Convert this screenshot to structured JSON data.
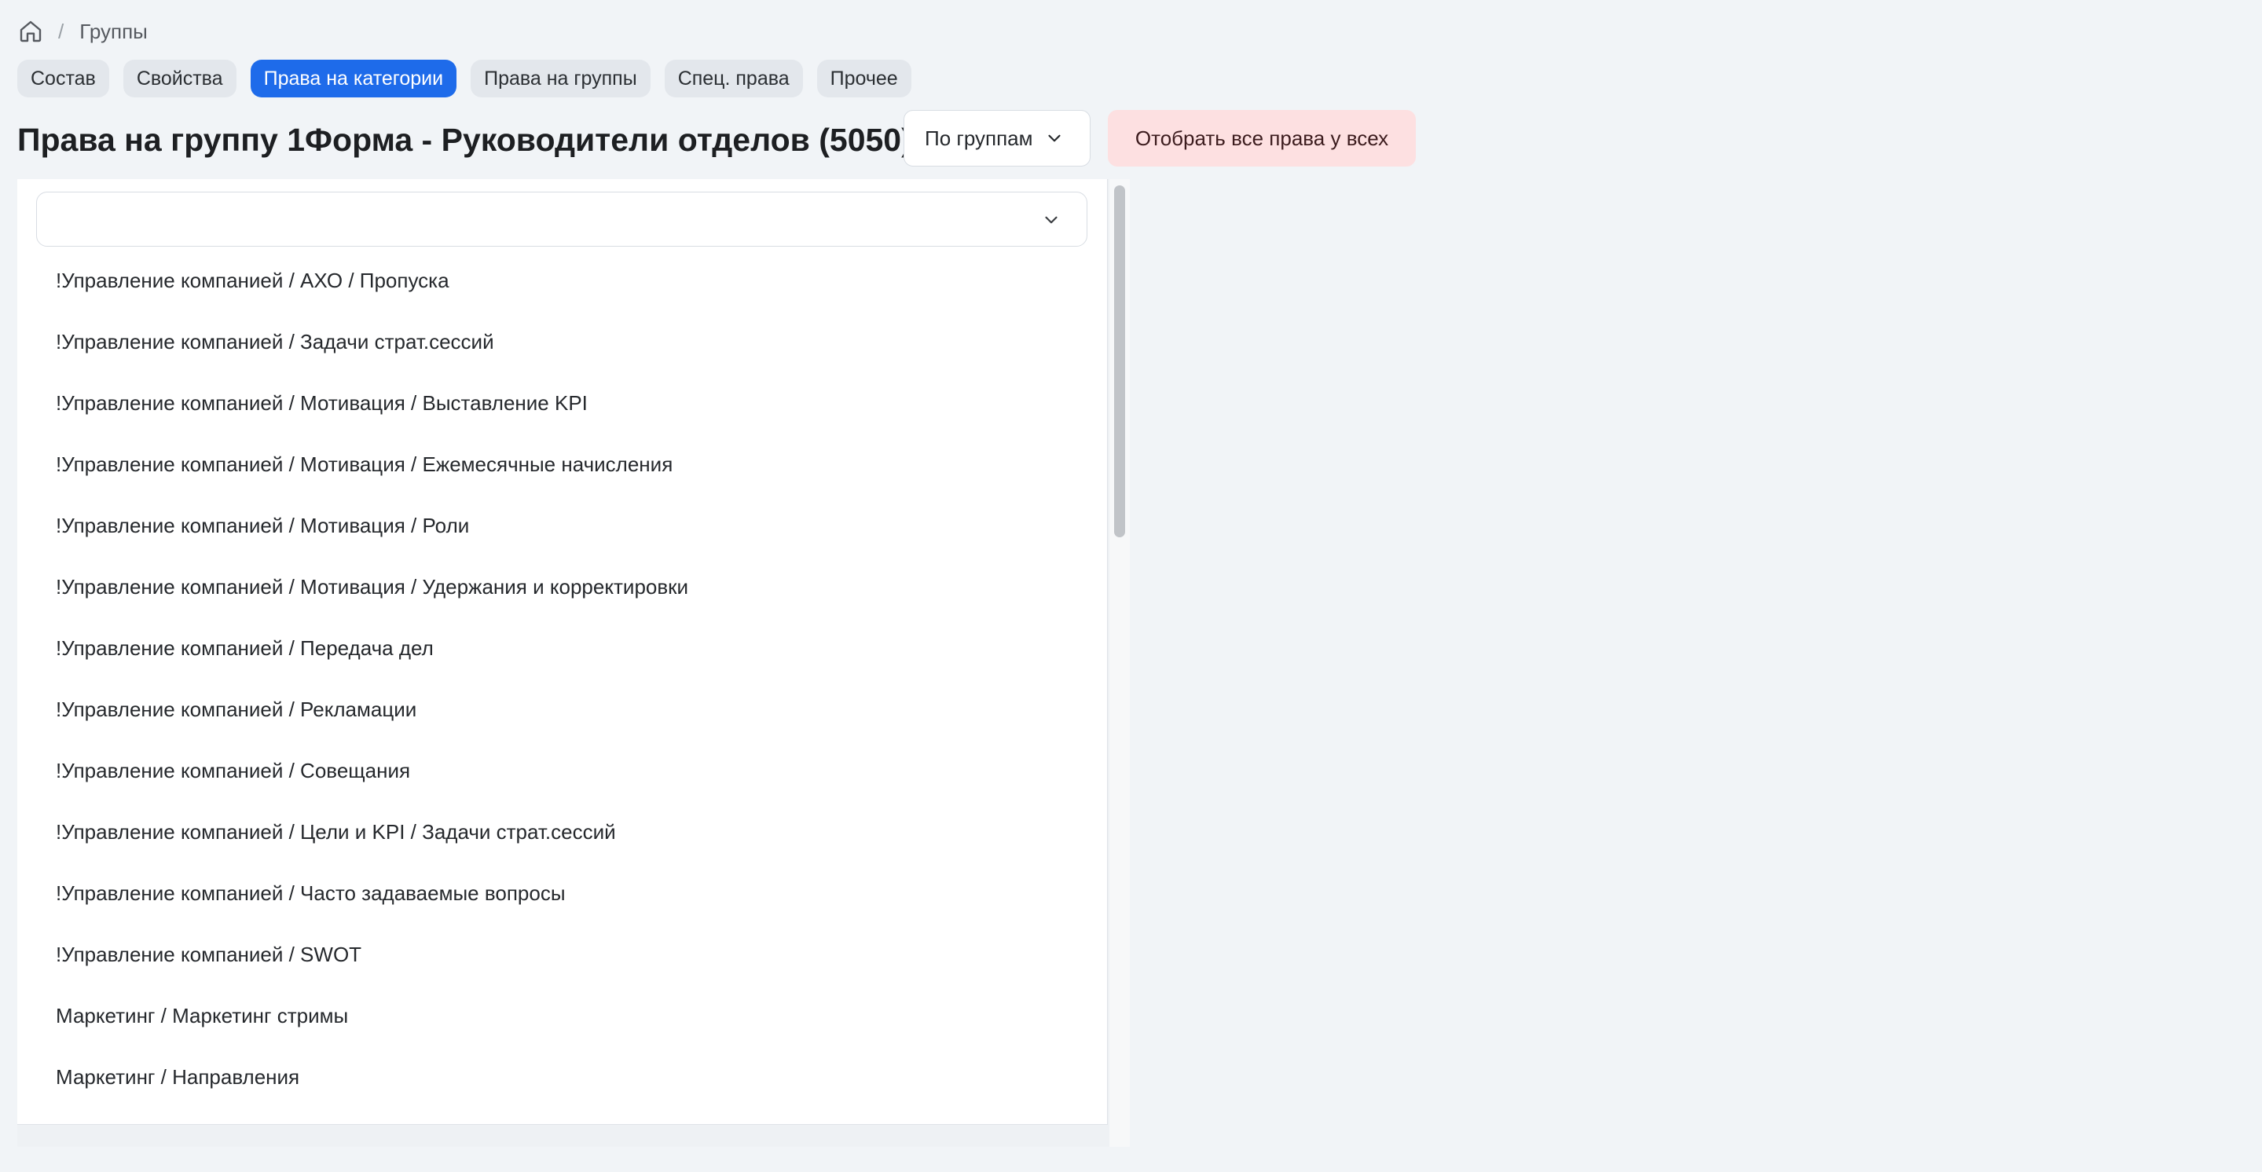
{
  "breadcrumb": {
    "home_icon": "home-icon",
    "separator": "/",
    "current": "Группы"
  },
  "tabs": [
    {
      "label": "Состав",
      "active": false
    },
    {
      "label": "Свойства",
      "active": false
    },
    {
      "label": "Права на категории",
      "active": true
    },
    {
      "label": "Права на группы",
      "active": false
    },
    {
      "label": "Спец. права",
      "active": false
    },
    {
      "label": "Прочее",
      "active": false
    }
  ],
  "header": {
    "title": "Права на группу 1Форма - Руководители отделов (5050)",
    "mode_select_value": "По группам",
    "revoke_all_label": "Отобрать все права у всех"
  },
  "category_select": {
    "value": ""
  },
  "categories": [
    "!Управление компанией / АХО / Пропуска",
    "!Управление компанией / Задачи страт.сессий",
    "!Управление компанией / Мотивация / Выставление KPI",
    "!Управление компанией / Мотивация / Ежемесячные начисления",
    "!Управление компанией / Мотивация / Роли",
    "!Управление компанией / Мотивация / Удержания и корректировки",
    "!Управление компанией / Передача дел",
    "!Управление компанией / Рекламации",
    "!Управление компанией / Совещания",
    "!Управление компанией / Цели и KPI / Задачи страт.сессий",
    "!Управление компанией / Часто задаваемые вопросы",
    "!Управление компанией / SWOT",
    "Маркетинг / Маркетинг стримы",
    "Маркетинг / Направления"
  ],
  "colors": {
    "accent": "#1e6bea",
    "danger_bg": "#fde0e1",
    "page_bg": "#f1f4f7"
  }
}
